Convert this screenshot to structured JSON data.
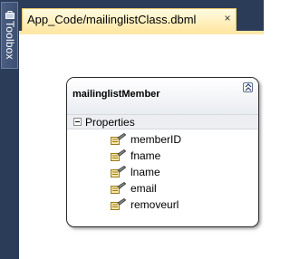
{
  "toolbox": {
    "label": "Toolbox",
    "icon": "toolbox-icon"
  },
  "tab": {
    "title": "App_Code/mailinglistClass.dbml",
    "close_glyph": "×"
  },
  "entity": {
    "name": "mailinglistMember",
    "section": "Properties",
    "properties": [
      "memberID",
      "fname",
      "lname",
      "email",
      "removeurl"
    ]
  },
  "colors": {
    "chrome": "#2b3c59",
    "active_tab": "#ffe8a6",
    "property_icon": "#d9b44a"
  }
}
